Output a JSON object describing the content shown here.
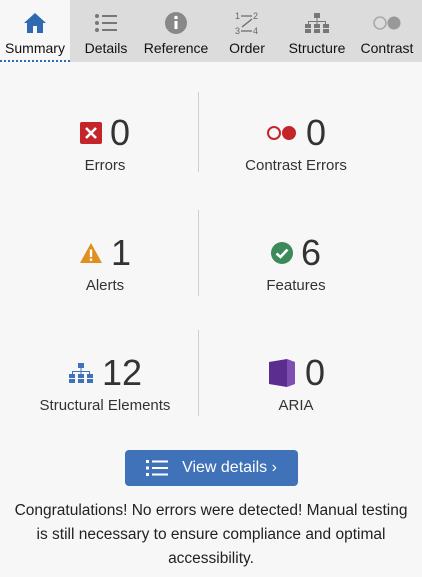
{
  "tabs": [
    {
      "label": "Summary",
      "icon": "home-icon",
      "active": true
    },
    {
      "label": "Details",
      "icon": "list-icon",
      "active": false
    },
    {
      "label": "Reference",
      "icon": "info-icon",
      "active": false
    },
    {
      "label": "Order",
      "icon": "order-icon",
      "active": false
    },
    {
      "label": "Structure",
      "icon": "structure-icon",
      "active": false
    },
    {
      "label": "Contrast",
      "icon": "contrast-icon",
      "active": false
    }
  ],
  "summary": {
    "errors": {
      "count": "0",
      "label": "Errors",
      "icon": "error-icon",
      "color": "#c4252b"
    },
    "contrast_errors": {
      "count": "0",
      "label": "Contrast Errors",
      "icon": "contrast-error-icon",
      "color": "#c4252b"
    },
    "alerts": {
      "count": "1",
      "label": "Alerts",
      "icon": "alert-icon",
      "color": "#e0901f"
    },
    "features": {
      "count": "6",
      "label": "Features",
      "icon": "feature-check-icon",
      "color": "#3c8a5a"
    },
    "structural": {
      "count": "12",
      "label": "Structural Elements",
      "icon": "structure-icon",
      "color": "#3f72b8"
    },
    "aria": {
      "count": "0",
      "label": "ARIA",
      "icon": "aria-icon",
      "color": "#5b2d8e"
    }
  },
  "view_details_button": {
    "label": "View details ›",
    "icon": "list-icon"
  },
  "message": "Congratulations! No errors were detected! Manual testing is still necessary to ensure compliance and optimal accessibility.",
  "colors": {
    "accent": "#3f72b8",
    "tab_bar": "#dcdcdc",
    "panel": "#f7f7f7"
  }
}
